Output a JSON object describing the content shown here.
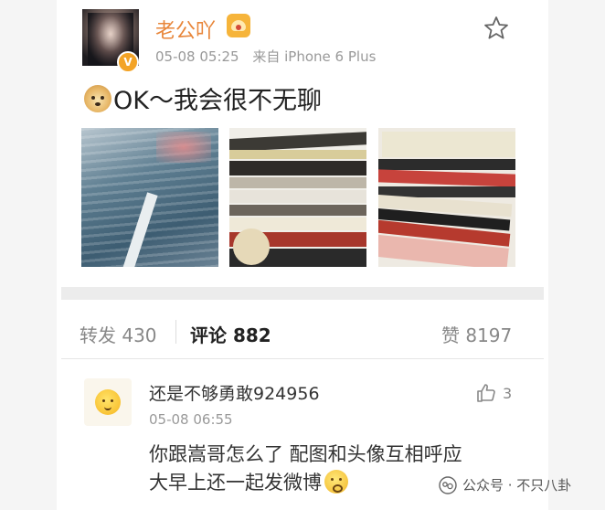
{
  "post": {
    "username": "老公吖",
    "timestamp": "05-08 05:25",
    "source": "来自 iPhone 6 Plus",
    "text": "OK～我会很不无聊",
    "emoji_icon": "doge-emoji",
    "photo_count": 3
  },
  "actions": {
    "repost_label": "转发",
    "repost_count": "430",
    "comment_label": "评论",
    "comment_count": "882",
    "like_label": "赞",
    "like_count": "8197"
  },
  "comment": {
    "username": "还是不够勇敢924956",
    "time": "05-08 06:55",
    "line1": "你跟嵩哥怎么了 配图和头像互相呼应",
    "line2": "大早上还一起发微博",
    "like_count": "3"
  },
  "watermark": {
    "text": "公众号 · 不只八卦"
  },
  "colors": {
    "username": "#e8863a",
    "muted": "#999999",
    "verified": "#f3a326"
  }
}
